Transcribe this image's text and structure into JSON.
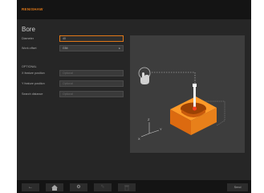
{
  "app": {
    "brand": "RENISHAW",
    "page_title": "Bore"
  },
  "form": {
    "diameter": {
      "label": "Diameter",
      "value": "40"
    },
    "work_offset": {
      "label": "Work offset",
      "value": "G54"
    },
    "section_title": "OPTIONAL",
    "x_feature_position": {
      "label": "X feature position",
      "placeholder": "Optional"
    },
    "y_feature_position": {
      "label": "Y feature position",
      "placeholder": "Optional"
    },
    "search_distance": {
      "label": "Search distance",
      "placeholder": "Optional"
    }
  },
  "preview": {
    "axis_labels": {
      "z": "Z",
      "y": "Y",
      "x": "X"
    }
  },
  "toolbar": {
    "back_icon": "arrow-left-icon",
    "home_icon": "home-icon",
    "settings_icon": "gear-icon",
    "edit_icon": "pencil-icon",
    "delete_icon": "trash-icon",
    "send_label": "Send"
  },
  "colors": {
    "accent": "#e07818",
    "background": "#262626",
    "bar": "#141414"
  }
}
